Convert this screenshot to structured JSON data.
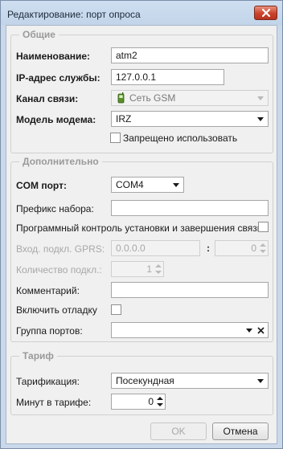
{
  "window": {
    "title": "Редактирование: порт опроса",
    "close_icon": "close-icon"
  },
  "general": {
    "legend": "Общие",
    "name_label": "Наименование:",
    "name_value": "atm2",
    "ip_label": "IP-адрес службы:",
    "ip_value": "127.0.0.1",
    "channel_label": "Канал связи:",
    "channel_value": "Сеть GSM",
    "channel_icon": "gsm-phone-icon",
    "modem_label": "Модель модема:",
    "modem_value": "IRZ",
    "forbidden_label": "Запрещено использовать",
    "forbidden_checked": false
  },
  "additional": {
    "legend": "Дополнительно",
    "com_label": "COM порт:",
    "com_value": "COM4",
    "prefix_label": "Префикс набора:",
    "prefix_value": "",
    "program_control_label": "Программный контроль установки и завершения связи",
    "program_control_checked": false,
    "gprs_label": "Вход. подкл. GPRS:",
    "gprs_ip_value": "0.0.0.0",
    "gprs_sep": ":",
    "gprs_port_value": "0",
    "conn_count_label": "Количество подкл.:",
    "conn_count_value": "1",
    "comment_label": "Комментарий:",
    "comment_value": "",
    "debug_label": "Включить отладку",
    "debug_checked": false,
    "port_group_label": "Группа портов:",
    "port_group_value": ""
  },
  "tariff": {
    "legend": "Тариф",
    "tarification_label": "Тарификация:",
    "tarification_value": "Посекундная",
    "minutes_label": "Минут в тарифе:",
    "minutes_value": "0"
  },
  "buttons": {
    "ok_label": "OK",
    "cancel_label": "Отмена"
  },
  "colors": {
    "title_bar": "#c9d8ea",
    "close_button": "#c9432b",
    "dialog_bg": "#f0f0f0",
    "legend_text": "#9a9a9a",
    "disabled_text": "#a8a8a8"
  }
}
